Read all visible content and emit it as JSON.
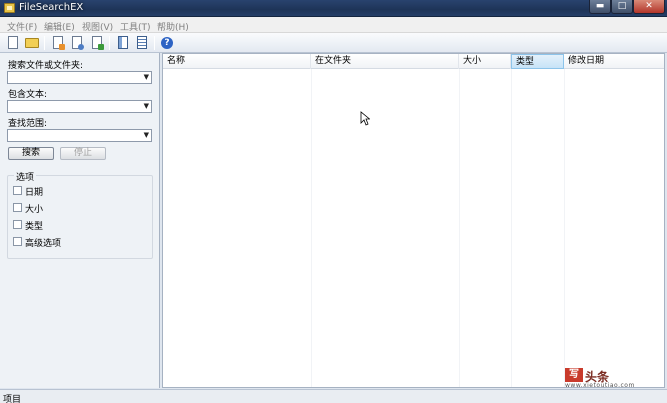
{
  "window": {
    "title": "FileSearchEX",
    "controls": {
      "minimize": "▬",
      "maximize": "□",
      "close": "✕"
    }
  },
  "menu": [
    {
      "label": "文件(F)"
    },
    {
      "label": "编辑(E)"
    },
    {
      "label": "视图(V)"
    },
    {
      "label": "工具(T)"
    },
    {
      "label": "帮助(H)"
    }
  ],
  "toolbar": {
    "buttons": [
      {
        "icon": "new-document-icon"
      },
      {
        "icon": "open-folder-icon"
      },
      {
        "icon": "document-orange-icon"
      },
      {
        "icon": "document-search-icon"
      },
      {
        "icon": "document-green-icon"
      },
      {
        "icon": "panel-left-icon"
      },
      {
        "icon": "panel-list-icon"
      },
      {
        "icon": "help-icon",
        "glyph": "?"
      }
    ]
  },
  "search_panel": {
    "search_label": "搜索文件或文件夹:",
    "search_value": "",
    "contains_label": "包含文本:",
    "contains_value": "",
    "location_label": "查找范围:",
    "location_value": "",
    "search_button": "搜索",
    "stop_button": "停止",
    "options_title": "选项",
    "options": [
      {
        "label": "日期",
        "checked": false
      },
      {
        "label": "大小",
        "checked": false
      },
      {
        "label": "类型",
        "checked": false
      },
      {
        "label": "高级选项",
        "checked": false
      }
    ]
  },
  "results": {
    "columns": [
      "名称",
      "在文件夹",
      "大小",
      "类型",
      "修改日期"
    ],
    "active_column": "类型",
    "rows": []
  },
  "status": {
    "text": "项目"
  },
  "watermark": {
    "logo": "写",
    "text": "头条",
    "url": "www.xietoutiao.com"
  },
  "colors": {
    "titlebar": "#1e3458",
    "panel": "#eef2f6",
    "active_header": "#c7e3f7"
  }
}
